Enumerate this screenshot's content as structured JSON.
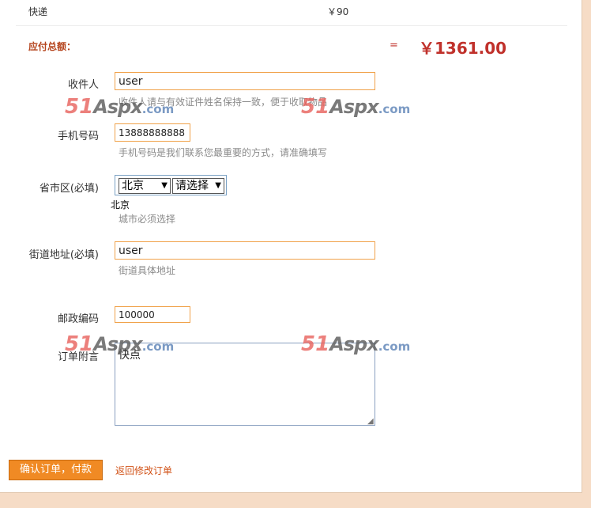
{
  "shipping": {
    "label": "快递",
    "price": "￥90"
  },
  "total": {
    "label": "应付总额：",
    "equals": "=",
    "amount": "￥1361.00"
  },
  "form": {
    "receiver": {
      "label": "收件人",
      "value": "user",
      "hint": "收件人请与有效证件姓名保持一致，便于收取物品"
    },
    "phone": {
      "label": "手机号码",
      "value": "13888888888",
      "hint": "手机号码是我们联系您最重要的方式，请准确填写"
    },
    "region": {
      "label": "省市区(必填)",
      "province": "北京",
      "city": "请选择",
      "selected_text": "北京",
      "hint": "城市必须选择"
    },
    "street": {
      "label": "街道地址(必填)",
      "value": "user",
      "hint": "街道具体地址"
    },
    "postcode": {
      "label": "邮政编码",
      "value": "100000"
    },
    "note": {
      "label": "订单附言",
      "value": "快点"
    }
  },
  "watermark": {
    "part1": "51",
    "part2": "Aspx",
    "part3": ".com"
  },
  "actions": {
    "confirm": "确认订单，付款",
    "back": "返回修改订单"
  },
  "colors": {
    "accent": "#f08a24",
    "price": "#c0312b",
    "total_label": "#b5441d",
    "link": "#d2541a"
  }
}
